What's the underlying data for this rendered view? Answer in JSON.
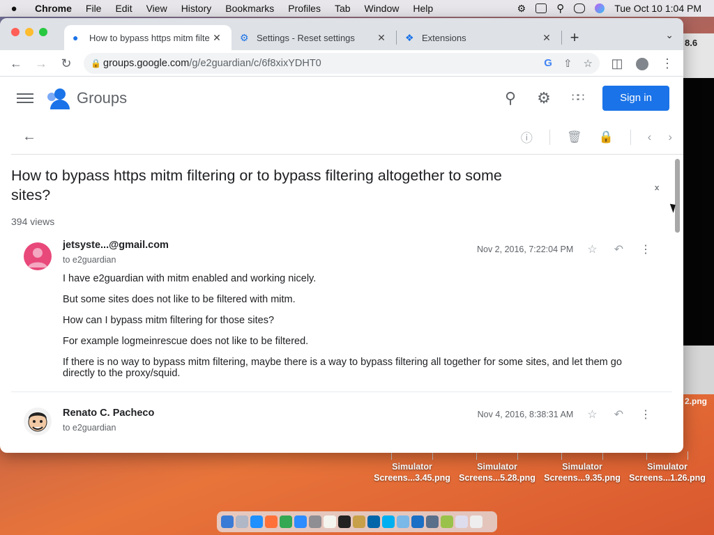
{
  "menubar": {
    "app": "Chrome",
    "items": [
      "File",
      "Edit",
      "View",
      "History",
      "Bookmarks",
      "Profiles",
      "Tab",
      "Window",
      "Help"
    ],
    "clock": "Tue Oct 10  1:04 PM"
  },
  "tabs": [
    {
      "title": "How to bypass https mitm filte",
      "active": true
    },
    {
      "title": "Settings - Reset settings",
      "active": false
    },
    {
      "title": "Extensions",
      "active": false
    }
  ],
  "address": {
    "host": "groups.google.com",
    "path": "/g/e2guardian/c/6f8xixYDHT0"
  },
  "header": {
    "product": "Groups",
    "signin_label": "Sign in"
  },
  "thread": {
    "subject": "How to bypass https mitm filtering or to bypass filtering altogether to some sites?",
    "views": "394 views",
    "messages": [
      {
        "sender": "jetsyste...@gmail.com",
        "recipient": "to e2guardian",
        "date": "Nov 2, 2016, 7:22:04 PM",
        "paragraphs": [
          "I have e2guardian with mitm enabled and working nicely.",
          "But some sites does not like to be filtered with mitm.",
          "How can I bypass mitm filtering for those sites?",
          "For example logmeinrescue does not like to be filtered.",
          "If there is no way to bypass mitm filtering, maybe there is a way to bypass filtering all together for some sites, and let them go directly to the proxy/squid."
        ]
      },
      {
        "sender": "Renato C. Pacheco",
        "recipient": "to e2guardian",
        "date": "Nov 4, 2016, 8:38:31 AM",
        "paragraphs": []
      }
    ]
  },
  "desktop": {
    "snippet": "8.6",
    "png_tail": "2.png",
    "files": [
      {
        "line1": "Simulator",
        "line2": "Screens...3.45.png"
      },
      {
        "line1": "Simulator",
        "line2": "Screens...5.28.png"
      },
      {
        "line1": "Simulator",
        "line2": "Screens...9.35.png"
      },
      {
        "line1": "Simulator",
        "line2": "Screens...1.26.png"
      }
    ]
  },
  "colors": {
    "accent": "#1a73e8",
    "avatar1": "#e8487a"
  }
}
